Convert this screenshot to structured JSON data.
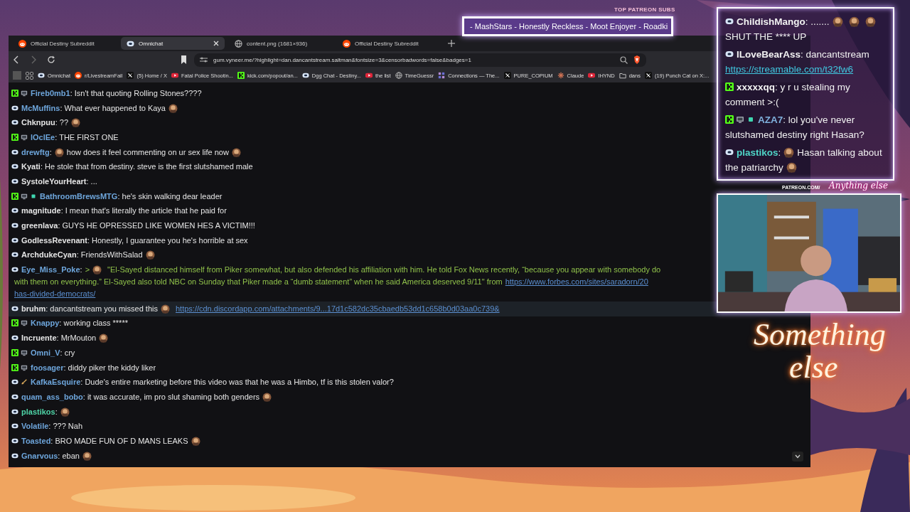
{
  "overlay": {
    "patreon_label": "TOP PATREON SUBS",
    "patreon_ticker": "- MashStars - Honestly Reckless - Moot Enjoyer - Roadki"
  },
  "browser": {
    "tabs": [
      {
        "title": "Official Destiny Subreddit",
        "kind": "reddit",
        "selected": false
      },
      {
        "title": "Omnichat",
        "kind": "dgg",
        "selected": true
      },
      {
        "title": "content.png (1681×936)",
        "kind": "globe",
        "selected": false
      },
      {
        "title": "Official Destiny Subreddit",
        "kind": "reddit",
        "selected": false
      }
    ],
    "url": "gum.vyneer.me/?highlight=dan.dancantstream.saltman&fontsize=3&censorbadwords=false&badges=1",
    "bookmarks": [
      {
        "label": "Omnichat",
        "kind": "dgg"
      },
      {
        "label": "r/LivestreamFail",
        "kind": "reddit"
      },
      {
        "label": "(5) Home / X",
        "kind": "x"
      },
      {
        "label": "Fatal Police Shootin...",
        "kind": "youtube"
      },
      {
        "label": "kick.com/popout/an...",
        "kind": "kick"
      },
      {
        "label": "Dgg Chat - Destiny...",
        "kind": "dgg"
      },
      {
        "label": "the list",
        "kind": "youtube"
      },
      {
        "label": "TimeGuessr",
        "kind": "globe"
      },
      {
        "label": "Connections — The...",
        "kind": "grid"
      },
      {
        "label": "PURE_COPIUM",
        "kind": "x"
      },
      {
        "label": "Claude",
        "kind": "claude"
      },
      {
        "label": "IHYND",
        "kind": "youtube"
      },
      {
        "label": "dans",
        "kind": "folder"
      },
      {
        "label": "(19) Punch Cat on X:...",
        "kind": "x"
      }
    ]
  },
  "chat": {
    "messages": [
      {
        "kind": "kick",
        "badges": [
          {
            "kind": "tv"
          }
        ],
        "user": "Fireb0mb1",
        "color": "#6ea6dc",
        "highlighted": false,
        "parts": [
          {
            "kind": "text",
            "text": ": Isn't that quoting Rolling Stones????"
          }
        ]
      },
      {
        "kind": "dgg",
        "user": "McMuffins",
        "color": "#6ea6dc",
        "highlighted": false,
        "parts": [
          {
            "kind": "text",
            "text": ": What ever happened to Kaya"
          },
          {
            "kind": "emote"
          }
        ]
      },
      {
        "kind": "dgg",
        "user": "Chknpuu",
        "color": "#e6e6e6",
        "highlighted": false,
        "parts": [
          {
            "kind": "text",
            "text": ": ??"
          },
          {
            "kind": "emote"
          }
        ]
      },
      {
        "kind": "kick",
        "badges": [
          {
            "kind": "tv"
          }
        ],
        "user": "lOclEe",
        "color": "#6ea6dc",
        "highlighted": false,
        "parts": [
          {
            "kind": "text",
            "text": ": THE FIRST ONE"
          }
        ]
      },
      {
        "kind": "dgg",
        "user": "drewftg",
        "color": "#6ea6dc",
        "highlighted": false,
        "parts": [
          {
            "kind": "text",
            "text": ":"
          },
          {
            "kind": "emote"
          },
          {
            "kind": "text",
            "text": "how does it feel commenting on ur sex life now"
          },
          {
            "kind": "emote"
          }
        ]
      },
      {
        "kind": "dgg",
        "user": "Kyati",
        "color": "#e6e6e6",
        "highlighted": false,
        "parts": [
          {
            "kind": "text",
            "text": ": He stole that from destiny. steve is the first slutshamed male"
          }
        ]
      },
      {
        "kind": "dgg",
        "user": "SystoleYourHeart",
        "color": "#e6e6e6",
        "highlighted": false,
        "parts": [
          {
            "kind": "text",
            "text": ": ..."
          }
        ]
      },
      {
        "kind": "kick",
        "badges": [
          {
            "kind": "tv"
          },
          {
            "kind": "gem"
          }
        ],
        "user": "BathroomBrewsMTG",
        "color": "#6ea6dc",
        "highlighted": false,
        "parts": [
          {
            "kind": "text",
            "text": ": he's skin walking dear leader"
          }
        ]
      },
      {
        "kind": "dgg",
        "user": "magnitude",
        "color": "#e6e6e6",
        "highlighted": false,
        "parts": [
          {
            "kind": "text",
            "text": ": I mean that's literally the article that he paid for"
          }
        ]
      },
      {
        "kind": "dgg",
        "user": "greenlava",
        "color": "#e6e6e6",
        "highlighted": false,
        "parts": [
          {
            "kind": "text",
            "text": ": GUYS HE OPRESSED LIKE WOMEN HES A VICTIM!!!"
          }
        ]
      },
      {
        "kind": "dgg",
        "user": "GodlessRevenant",
        "color": "#e6e6e6",
        "highlighted": false,
        "parts": [
          {
            "kind": "text",
            "text": ": Honestly, I guarantee you he's horrible at sex"
          }
        ]
      },
      {
        "kind": "dgg",
        "user": "ArchdukeCyan",
        "color": "#e6e6e6",
        "highlighted": false,
        "parts": [
          {
            "kind": "text",
            "text": ": FriendsWithSalad"
          },
          {
            "kind": "emote"
          }
        ]
      },
      {
        "kind": "dgg",
        "user": "Eye_Miss_Poke",
        "color": "#6ea6dc",
        "highlighted": false,
        "parts": [
          {
            "kind": "text",
            "text": ":"
          },
          {
            "kind": "quote",
            "text": ">"
          },
          {
            "kind": "emote"
          },
          {
            "kind": "quote",
            "text": "\"El-Sayed distanced himself from Piker somewhat, but also defended his affiliation with him. He told Fox News recently, “because you appear with somebody do"
          },
          {
            "kind": "break"
          },
          {
            "kind": "quote",
            "text": "with them on everything.” El-Sayed also told NBC on Sunday that Piker made a “dumb statement” when he said America deserved 9/11\" from"
          },
          {
            "kind": "link",
            "text": "https://www.forbes.com/sites/saradorn/20"
          },
          {
            "kind": "break"
          },
          {
            "kind": "link",
            "text": "has-divided-democrats/"
          }
        ]
      },
      {
        "kind": "dgg",
        "user": "bruhm",
        "color": "#e6e6e6",
        "highlighted": true,
        "parts": [
          {
            "kind": "text",
            "text": ": dancantstream you missed this"
          },
          {
            "kind": "emote"
          },
          {
            "kind": "link",
            "text": "https://cdn.discordapp.com/attachments/9...17d1c582dc35cbaedb53dd1c658b0d03aa0c739&"
          }
        ]
      },
      {
        "kind": "kick",
        "badges": [
          {
            "kind": "tv"
          }
        ],
        "user": "Knappy",
        "color": "#6ea6dc",
        "highlighted": false,
        "parts": [
          {
            "kind": "text",
            "text": ": working class *****"
          }
        ]
      },
      {
        "kind": "dgg",
        "user": "Incruente",
        "color": "#e6e6e6",
        "highlighted": false,
        "parts": [
          {
            "kind": "text",
            "text": ": MrMouton"
          },
          {
            "kind": "emote"
          }
        ]
      },
      {
        "kind": "kick",
        "badges": [
          {
            "kind": "tv"
          }
        ],
        "user": "Omni_V",
        "color": "#6ea6dc",
        "highlighted": false,
        "parts": [
          {
            "kind": "text",
            "text": ": cry"
          }
        ]
      },
      {
        "kind": "kick",
        "badges": [
          {
            "kind": "tv"
          }
        ],
        "user": "foosager",
        "color": "#6ea6dc",
        "highlighted": false,
        "parts": [
          {
            "kind": "text",
            "text": ": diddy piker the kiddy liker"
          }
        ]
      },
      {
        "kind": "dgg",
        "badges": [
          {
            "kind": "sword"
          }
        ],
        "user": "KafkaEsquire",
        "color": "#6ea6dc",
        "highlighted": false,
        "parts": [
          {
            "kind": "text",
            "text": ": Dude's entire marketing before this video was that he was a Himbo, tf is this stolen valor?"
          }
        ]
      },
      {
        "kind": "dgg",
        "user": "quam_ass_bobo",
        "color": "#6ea6dc",
        "highlighted": false,
        "parts": [
          {
            "kind": "text",
            "text": ": it was accurate, im pro slut shaming both genders"
          },
          {
            "kind": "emote"
          }
        ]
      },
      {
        "kind": "dgg",
        "user": "plastikos",
        "color": "#4fd6a8",
        "highlighted": false,
        "parts": [
          {
            "kind": "text",
            "text": ":"
          },
          {
            "kind": "emote"
          }
        ]
      },
      {
        "kind": "dgg",
        "user": "Volatile",
        "color": "#6ea6dc",
        "highlighted": false,
        "parts": [
          {
            "kind": "text",
            "text": ": ??? Nah"
          }
        ]
      },
      {
        "kind": "dgg",
        "user": "Toasted",
        "color": "#6ea6dc",
        "highlighted": false,
        "parts": [
          {
            "kind": "text",
            "text": ": BRO MADE FUN OF D MANS LEAKS"
          },
          {
            "kind": "emote"
          }
        ]
      },
      {
        "kind": "dgg",
        "user": "Gnarvous",
        "color": "#6ea6dc",
        "highlighted": false,
        "parts": [
          {
            "kind": "text",
            "text": ": eban"
          },
          {
            "kind": "emote"
          }
        ]
      }
    ]
  },
  "stream_chat": {
    "messages": [
      {
        "kind": "dgg",
        "user": "ChildishMango",
        "color": "#f2f2f2",
        "parts": [
          {
            "kind": "text",
            "text": ": ......."
          },
          {
            "kind": "emote"
          },
          {
            "kind": "emote"
          },
          {
            "kind": "emote"
          },
          {
            "kind": "break"
          },
          {
            "kind": "text",
            "text": "SHUT THE **** UP"
          }
        ]
      },
      {
        "kind": "dgg",
        "user": "ILoveBearAss",
        "color": "#f2f2f2",
        "parts": [
          {
            "kind": "text",
            "text": ": dancantstream"
          },
          {
            "kind": "break"
          },
          {
            "kind": "link",
            "text": "https://streamable.com/t32fw6"
          }
        ]
      },
      {
        "kind": "kick",
        "user": "xxxxxqq",
        "color": "#f2f2f2",
        "parts": [
          {
            "kind": "text",
            "text": ": y r u stealing my"
          },
          {
            "kind": "break"
          },
          {
            "kind": "text",
            "text": "comment >:("
          }
        ]
      },
      {
        "kind": "kick",
        "badges": [
          {
            "kind": "tv"
          },
          {
            "kind": "gem"
          }
        ],
        "user": "AZA7",
        "color": "#7fb0dc",
        "parts": [
          {
            "kind": "text",
            "text": ": lol you've never"
          },
          {
            "kind": "break"
          },
          {
            "kind": "text",
            "text": "slutshamed destiny right Hasan?"
          }
        ]
      },
      {
        "kind": "dgg",
        "user": "plastikos",
        "color": "#4fd6c8",
        "parts": [
          {
            "kind": "text",
            "text": ":"
          },
          {
            "kind": "emote"
          },
          {
            "kind": "text",
            "text": "Hasan talking about"
          },
          {
            "kind": "break"
          },
          {
            "kind": "text",
            "text": "the patriarchy"
          },
          {
            "kind": "emote"
          }
        ]
      }
    ]
  },
  "brand": {
    "link": "PATREON.COM/",
    "script": "Anything else",
    "sign_1": "Something",
    "sign_2": "else"
  }
}
